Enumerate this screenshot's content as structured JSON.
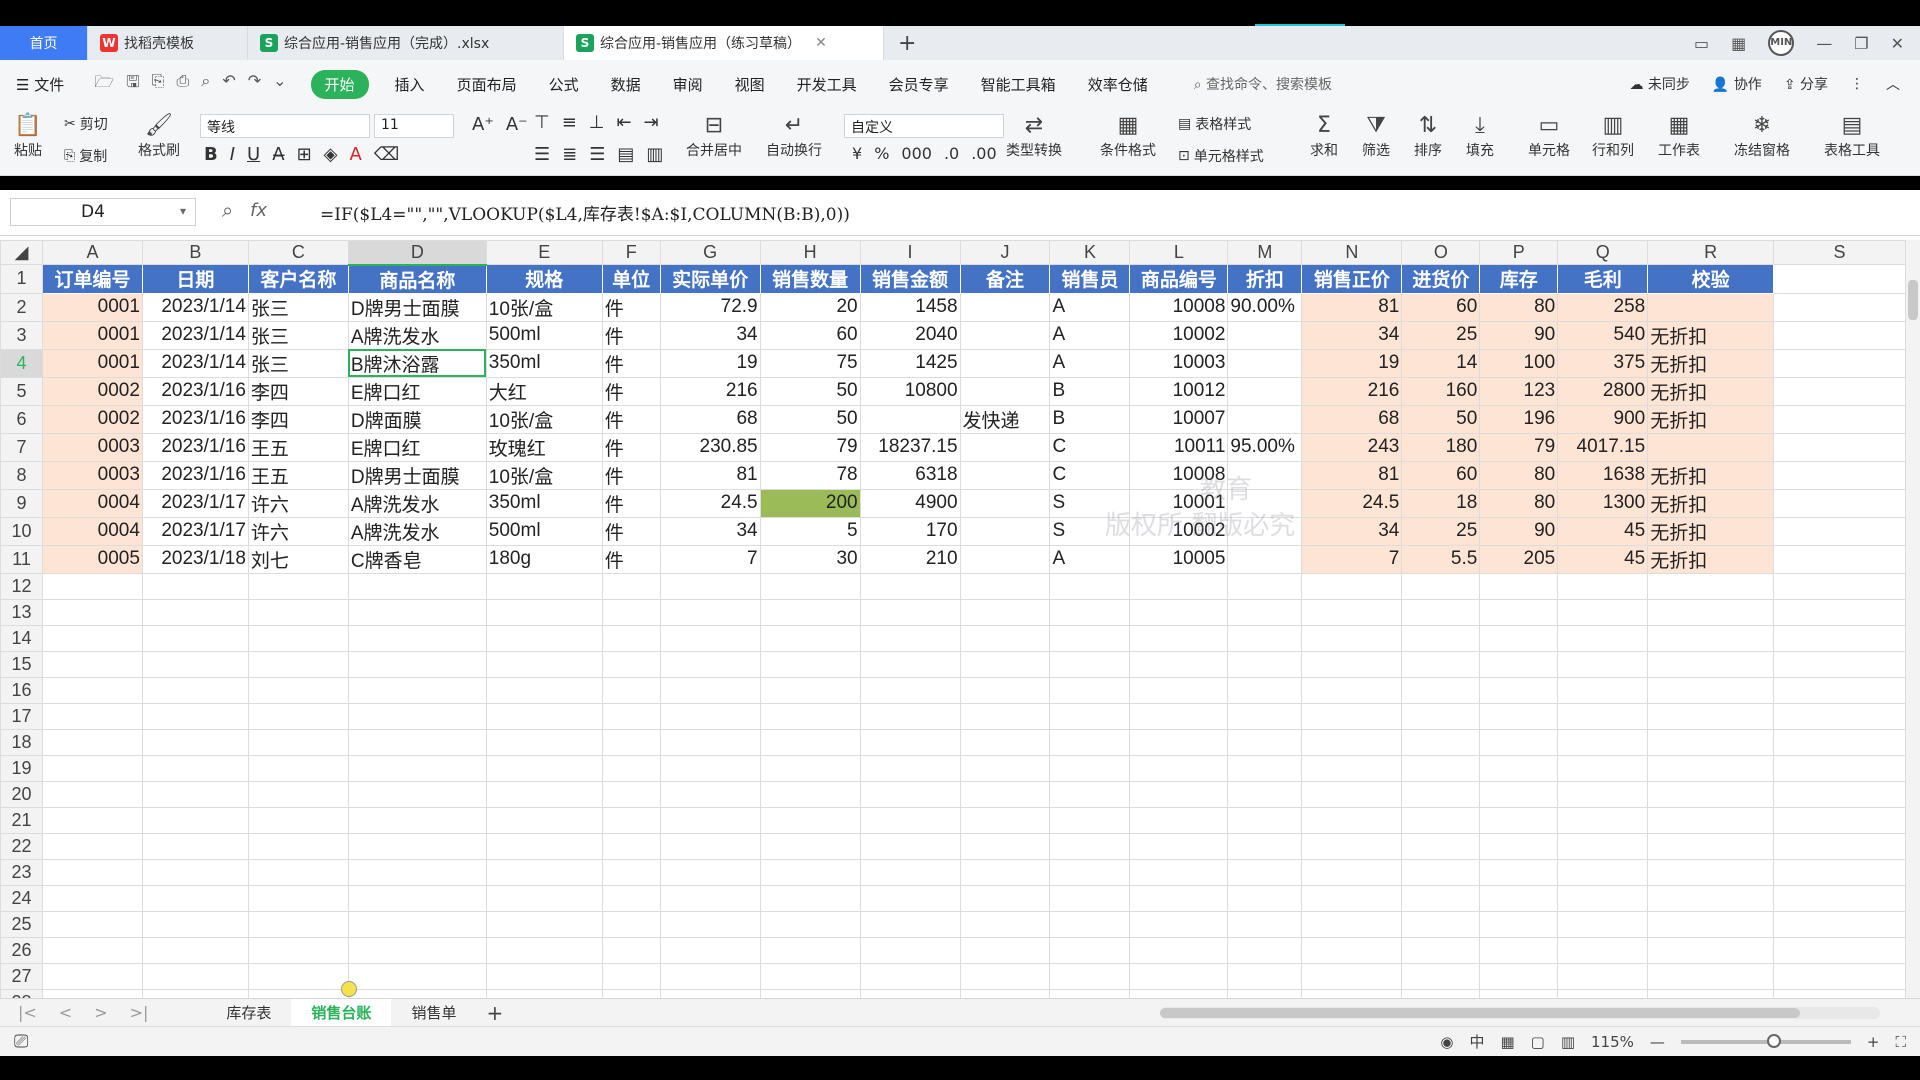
{
  "tabs": [
    {
      "label": "首页"
    },
    {
      "label": "找稻壳模板"
    },
    {
      "label": "综合应用-销售应用（完成）.xlsx"
    },
    {
      "label": "综合应用-销售应用（练习草稿）"
    }
  ],
  "user_avatar": "MIN",
  "menu": {
    "file": "文件",
    "items": [
      "开始",
      "插入",
      "页面布局",
      "公式",
      "数据",
      "审阅",
      "视图",
      "开发工具",
      "会员专享",
      "智能工具箱",
      "效率仓储"
    ],
    "search": "查找命令、搜索模板",
    "sync": "未同步",
    "collab": "协作",
    "share": "分享"
  },
  "ribbon": {
    "paste": "粘贴",
    "cut": "剪切",
    "copy": "复制",
    "format_painter": "格式刷",
    "font_name": "等线",
    "font_size": "11",
    "merge": "合并居中",
    "wrap": "自动换行",
    "number_format": "自定义",
    "type_convert": "类型转换",
    "cond_format": "条件格式",
    "table_style": "表格样式",
    "cell_style": "单元格样式",
    "sum": "求和",
    "filter": "筛选",
    "sort": "排序",
    "fill": "填充",
    "cell": "单元格",
    "row_col": "行和列",
    "worksheet": "工作表",
    "freeze": "冻结窗格",
    "table_tools": "表格工具"
  },
  "formula_bar": {
    "name_box": "D4",
    "fx": "fx",
    "formula": "=IF($L4=\"\",\"\",VLOOKUP($L4,库存表!$A:$I,COLUMN(B:B),0))"
  },
  "columns": [
    "A",
    "B",
    "C",
    "D",
    "E",
    "F",
    "G",
    "H",
    "I",
    "J",
    "K",
    "L",
    "M",
    "N",
    "O",
    "P",
    "Q",
    "R",
    "S"
  ],
  "header_row": [
    "订单编号",
    "日期",
    "客户名称",
    "商品名称",
    "规格",
    "单位",
    "实际单价",
    "销售数量",
    "销售金额",
    "备注",
    "销售员",
    "商品编号",
    "折扣",
    "销售正价",
    "进货价",
    "库存",
    "毛利",
    "校验"
  ],
  "rows": [
    [
      "0001",
      "2023/1/14",
      "张三",
      "D牌男士面膜",
      "10张/盒",
      "件",
      "72.9",
      "20",
      "1458",
      "",
      "A",
      "10008",
      "90.00%",
      "81",
      "60",
      "80",
      "258",
      ""
    ],
    [
      "0001",
      "2023/1/14",
      "张三",
      "A牌洗发水",
      "500ml",
      "件",
      "34",
      "60",
      "2040",
      "",
      "A",
      "10002",
      "",
      "34",
      "25",
      "90",
      "540",
      "无折扣"
    ],
    [
      "0001",
      "2023/1/14",
      "张三",
      "B牌沐浴露",
      "350ml",
      "件",
      "19",
      "75",
      "1425",
      "",
      "A",
      "10003",
      "",
      "19",
      "14",
      "100",
      "375",
      "无折扣"
    ],
    [
      "0002",
      "2023/1/16",
      "李四",
      "E牌口红",
      "大红",
      "件",
      "216",
      "50",
      "10800",
      "",
      "B",
      "10012",
      "",
      "216",
      "160",
      "123",
      "2800",
      "无折扣"
    ],
    [
      "0002",
      "2023/1/16",
      "李四",
      "D牌面膜",
      "10张/盒",
      "件",
      "68",
      "50",
      "",
      "发快递",
      "B",
      "10007",
      "",
      "68",
      "50",
      "196",
      "900",
      "无折扣"
    ],
    [
      "0003",
      "2023/1/16",
      "王五",
      "E牌口红",
      "玫瑰红",
      "件",
      "230.85",
      "79",
      "18237.15",
      "",
      "C",
      "10011",
      "95.00%",
      "243",
      "180",
      "79",
      "4017.15",
      ""
    ],
    [
      "0003",
      "2023/1/16",
      "王五",
      "D牌男士面膜",
      "10张/盒",
      "件",
      "81",
      "78",
      "6318",
      "",
      "C",
      "10008",
      "",
      "81",
      "60",
      "80",
      "1638",
      "无折扣"
    ],
    [
      "0004",
      "2023/1/17",
      "许六",
      "A牌洗发水",
      "350ml",
      "件",
      "24.5",
      "200",
      "4900",
      "",
      "S",
      "10001",
      "",
      "24.5",
      "18",
      "80",
      "1300",
      "无折扣"
    ],
    [
      "0004",
      "2023/1/17",
      "许六",
      "A牌洗发水",
      "500ml",
      "件",
      "34",
      "5",
      "170",
      "",
      "S",
      "10002",
      "",
      "34",
      "25",
      "90",
      "45",
      "无折扣"
    ],
    [
      "0005",
      "2023/1/18",
      "刘七",
      "C牌香皂",
      "180g",
      "件",
      "7",
      "30",
      "210",
      "",
      "A",
      "10005",
      "",
      "7",
      "5.5",
      "205",
      "45",
      "无折扣"
    ]
  ],
  "total_rows": 28,
  "watermark": [
    "教育",
    "版权所 翻版必究"
  ],
  "sheets": [
    "库存表",
    "销售台账",
    "销售单"
  ],
  "active_sheet": "销售台账",
  "zoom": "115%",
  "colors": {
    "header_blue": "#4472c4",
    "pink": "#fde4d4",
    "green_select": "#2bb25a",
    "green_cell": "#9bbb59"
  }
}
